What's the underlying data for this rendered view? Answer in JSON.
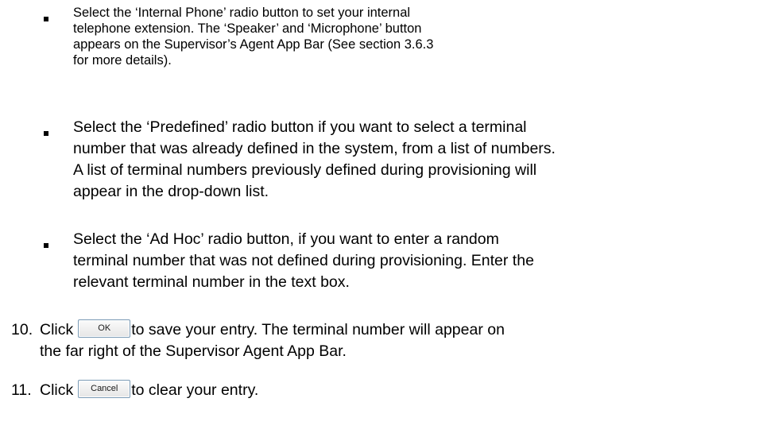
{
  "bullets": [
    {
      "lines": [
        "Select the ‘Internal Phone’ radio button to set your internal",
        "telephone extension. The ‘Speaker’ and ‘Microphone’ button",
        "appears on the Supervisor’s Agent App Bar (See section 3.6.3",
        "for more details)."
      ]
    },
    {
      "lines": [
        "Select the ‘Predefined’ radio button if you want to select a terminal",
        "number that was already defined in the system, from a list of numbers.",
        "A list of terminal numbers previously defined during provisioning will",
        "appear in the drop-down list."
      ]
    },
    {
      "lines": [
        "Select the ‘Ad Hoc’ radio button, if you want to enter a random",
        "terminal number that was not defined during provisioning. Enter the",
        "relevant terminal number in the text box."
      ]
    }
  ],
  "steps": [
    {
      "number": "10.",
      "before": "Click",
      "button_label": "OK",
      "after": "to save your entry. The terminal number will appear on",
      "continuation": "the far right of the Supervisor Agent App Bar."
    },
    {
      "number": "11.",
      "before": "Click",
      "button_label": "Cancel",
      "after": "to clear your entry."
    }
  ]
}
